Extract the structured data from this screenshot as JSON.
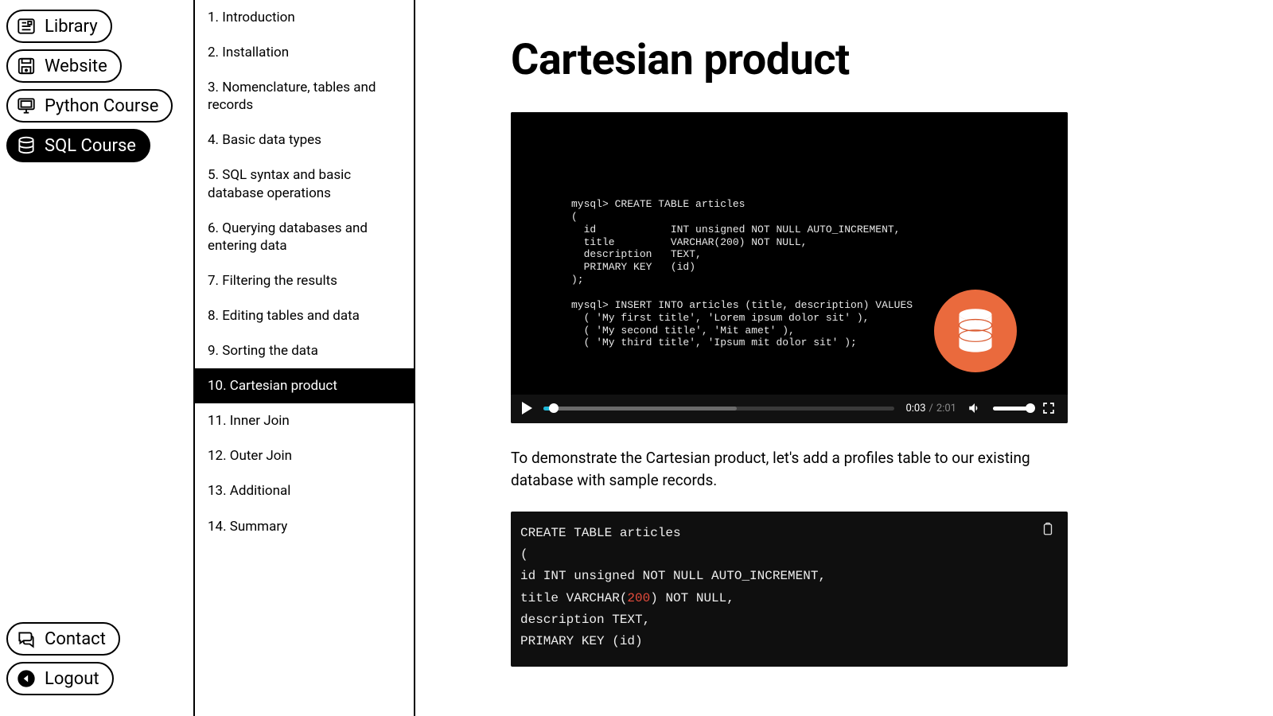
{
  "rail": {
    "top": [
      {
        "id": "library",
        "label": "Library",
        "icon": "newspaper"
      },
      {
        "id": "website",
        "label": "Website",
        "icon": "save-disk"
      },
      {
        "id": "python-course",
        "label": "Python Course",
        "icon": "monitor"
      },
      {
        "id": "sql-course",
        "label": "SQL Course",
        "icon": "database",
        "active": true
      }
    ],
    "bottom": [
      {
        "id": "contact",
        "label": "Contact",
        "icon": "chat"
      },
      {
        "id": "logout",
        "label": "Logout",
        "icon": "arrow-circle"
      }
    ]
  },
  "lessons": {
    "activeIndex": 9,
    "items": [
      "1. Introduction",
      "2. Installation",
      "3. Nomenclature, tables and records",
      "4. Basic data types",
      "5. SQL syntax and basic database operations",
      "6. Querying databases and entering data",
      "7. Filtering the results",
      "8. Editing tables and data",
      "9. Sorting the data",
      "10. Cartesian product",
      "11. Inner Join",
      "12. Outer Join",
      "13. Additional",
      "14. Summary"
    ]
  },
  "page": {
    "title": "Cartesian product",
    "bodyText": "To demonstrate the Cartesian product, let's add a profiles table to our existing database with sample records."
  },
  "video": {
    "codeOverlay": "mysql> CREATE TABLE articles\n(\n  id            INT unsigned NOT NULL AUTO_INCREMENT,\n  title         VARCHAR(200) NOT NULL,\n  description   TEXT,\n  PRIMARY KEY   (id)\n);\n\nmysql> INSERT INTO articles (title, description) VALUES\n  ( 'My first title', 'Lorem ipsum dolor sit' ),\n  ( 'My second title', 'Mit amet' ),\n  ( 'My third title', 'Ipsum mit dolor sit' );",
    "currentTime": "0:03",
    "duration": "2:01",
    "seekPercent": 3,
    "bufferPercent": 55
  },
  "codeBlock": {
    "l1": "CREATE TABLE articles",
    "l2": "(",
    "l3": "id INT unsigned NOT NULL AUTO_INCREMENT,",
    "l4a": "title VARCHAR(",
    "l4num": "200",
    "l4b": ") NOT NULL,",
    "l5": "description TEXT,",
    "l6": "PRIMARY KEY (id)"
  }
}
